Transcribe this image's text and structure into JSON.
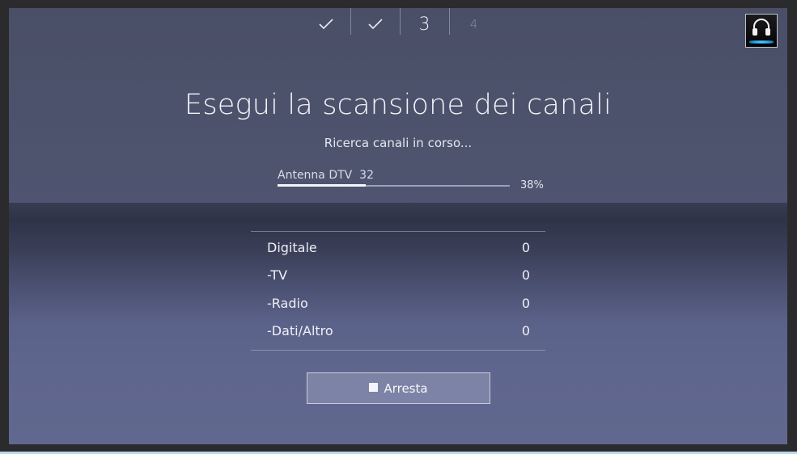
{
  "stepper": {
    "steps": [
      {
        "state": "done",
        "icon": "check-icon"
      },
      {
        "state": "done",
        "icon": "check-icon"
      },
      {
        "state": "current",
        "label": "3"
      },
      {
        "state": "pending",
        "label": "4"
      }
    ]
  },
  "headset": {
    "icon": "headset-icon"
  },
  "title": "Esegui la scansione dei canali",
  "subtitle": "Ricerca canali in corso...",
  "progress": {
    "source": "Antenna DTV",
    "channel": "32",
    "percent_label": "38%",
    "fraction": 0.38
  },
  "results": [
    {
      "label": "Digitale",
      "value": "0"
    },
    {
      "label": "-TV",
      "value": "0"
    },
    {
      "label": "-Radio",
      "value": "0"
    },
    {
      "label": "-Dati/Altro",
      "value": "0"
    }
  ],
  "stop_button": {
    "label": "Arresta",
    "icon": "stop-icon"
  },
  "colors": {
    "accent_glow": "#1a8fd6"
  }
}
